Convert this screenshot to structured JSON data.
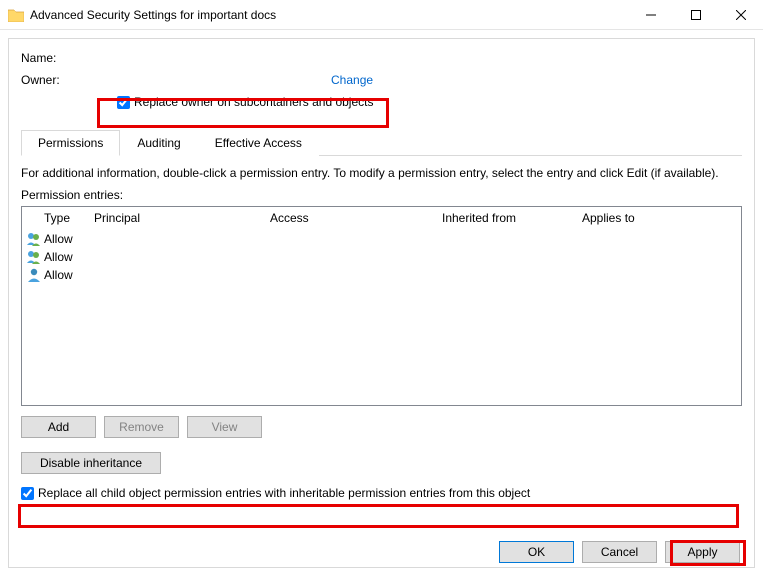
{
  "window": {
    "title": "Advanced Security Settings for important docs"
  },
  "labels": {
    "name": "Name:",
    "owner": "Owner:"
  },
  "owner": {
    "change_link": "Change",
    "replace_checkbox": "Replace owner on subcontainers and objects"
  },
  "tabs": {
    "permissions": "Permissions",
    "auditing": "Auditing",
    "effective": "Effective Access"
  },
  "info_text": "For additional information, double-click a permission entry. To modify a permission entry, select the entry and click Edit (if available).",
  "entries_label": "Permission entries:",
  "columns": {
    "type": "Type",
    "principal": "Principal",
    "access": "Access",
    "inherited": "Inherited from",
    "applies": "Applies to"
  },
  "entries": [
    {
      "type": "Allow",
      "icon": "group"
    },
    {
      "type": "Allow",
      "icon": "group"
    },
    {
      "type": "Allow",
      "icon": "user"
    }
  ],
  "buttons": {
    "add": "Add",
    "remove": "Remove",
    "view": "View",
    "disable_inheritance": "Disable inheritance",
    "ok": "OK",
    "cancel": "Cancel",
    "apply": "Apply"
  },
  "child_checkbox": "Replace all child object permission entries with inheritable permission entries from this object"
}
